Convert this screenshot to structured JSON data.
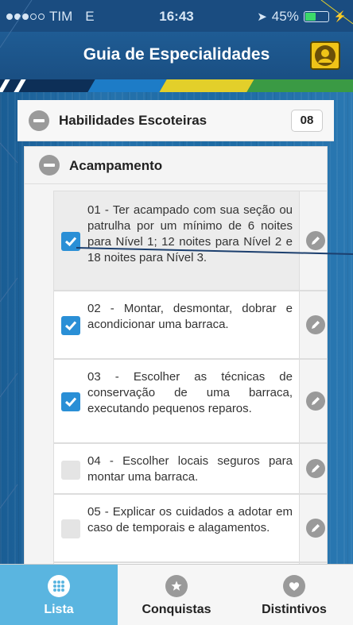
{
  "status_bar": {
    "carrier": "TIM",
    "network": "E",
    "time": "16:43",
    "battery": "45%",
    "battery_level": 0.45
  },
  "header": {
    "title": "Guia de Especialidades",
    "profile_icon": "user-icon"
  },
  "category": {
    "title": "Habilidades Escoteiras",
    "count": "08"
  },
  "section": {
    "title": "Acampamento"
  },
  "items": [
    {
      "text": "01 - Ter acampado com sua seção ou patrulha por um mínimo de 6 noites para Nível 1; 12 noites para Nível 2 e 18 noites para Nível 3.",
      "checked": true
    },
    {
      "text": "02 - Montar, desmontar, dobrar e acondicionar uma barraca.",
      "checked": true
    },
    {
      "text": "03 - Escolher as técnicas de conservação de uma barraca, executando pequenos reparos.",
      "checked": true
    },
    {
      "text": "04 - Escolher locais seguros para montar uma barraca.",
      "checked": false
    },
    {
      "text": "05 - Explicar os cuidados a adotar em caso de temporais e alagamentos.",
      "checked": false
    }
  ],
  "tabs": [
    {
      "label": "Lista",
      "icon": "grid-icon",
      "active": true
    },
    {
      "label": "Conquistas",
      "icon": "star-icon",
      "active": false
    },
    {
      "label": "Distintivos",
      "icon": "heart-icon",
      "active": false
    }
  ],
  "colors": {
    "accent": "#2a8fd6",
    "tab_active": "#5ab5e0",
    "profile_button": "#f0c418"
  }
}
